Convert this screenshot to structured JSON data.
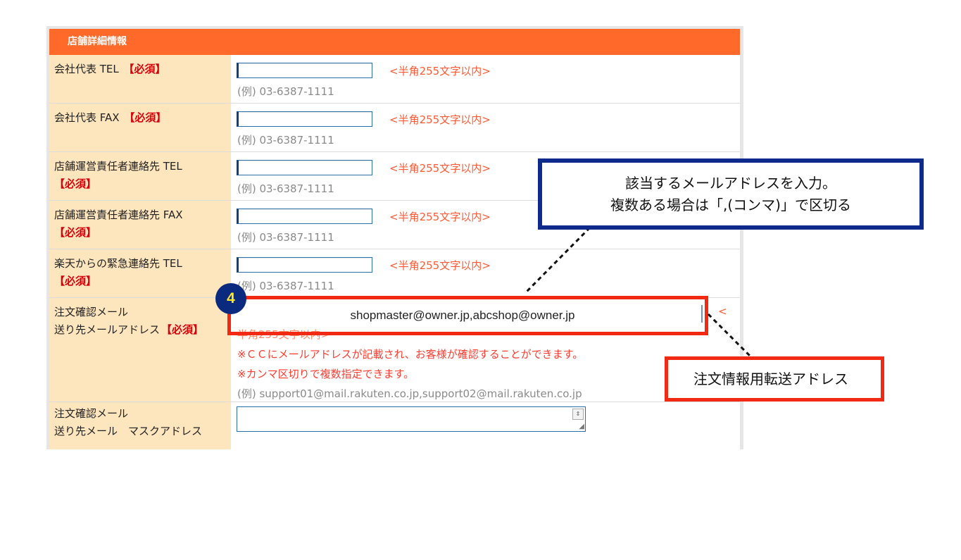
{
  "section_title": "店舗詳細情報",
  "required_mark": "【必須】",
  "rows": [
    {
      "label": "会社代表 TEL",
      "limit": "<半角255文字以内>",
      "example": "(例) 03-6387-1111"
    },
    {
      "label": "会社代表 FAX",
      "limit": "<半角255文字以内>",
      "example": "(例) 03-6387-1111"
    },
    {
      "label": "店舗運営責任者連絡先 TEL",
      "limit": "<半角255文字以内>",
      "example": "(例) 03-6387-1111"
    },
    {
      "label": "店舗運営責任者連絡先 FAX",
      "limit": "<半角255文字以内>",
      "example": "(例) 03-6387-1111"
    },
    {
      "label": "楽天からの緊急連絡先 TEL",
      "limit": "<半角255文字以内>",
      "example": "(例) 03-6387-1111"
    }
  ],
  "email_row": {
    "label_line1": "注文確認メール",
    "label_line2": "送り先メールアドレス",
    "value": "shopmaster@owner.jp,abcshop@owner.jp",
    "limit_partial": "<",
    "limit_below": "半角255文字以内>",
    "note_cc": "※ＣＣにメールアドレスが記載され、お客様が確認することができます。",
    "note_comma": "※カンマ区切りで複数指定できます。",
    "example": "(例) support01@mail.rakuten.co.jp,support02@mail.rakuten.co.jp"
  },
  "mask_row": {
    "label_line1": "注文確認メール",
    "label_line2": "送り先メール　マスクアドレス"
  },
  "step_badge": "4",
  "callout_blue": {
    "line1": "該当するメールアドレスを入力。",
    "line2": "複数ある場合は「,(コンマ)」で区切る"
  },
  "callout_red": "注文情報用転送アドレス",
  "colors": {
    "header": "#ff6a2a",
    "label_bg": "#fde5bd",
    "required": "#d8000a",
    "highlight_red": "#f22a14",
    "callout_blue": "#0d2a8c",
    "badge_text": "#ffe91f"
  }
}
